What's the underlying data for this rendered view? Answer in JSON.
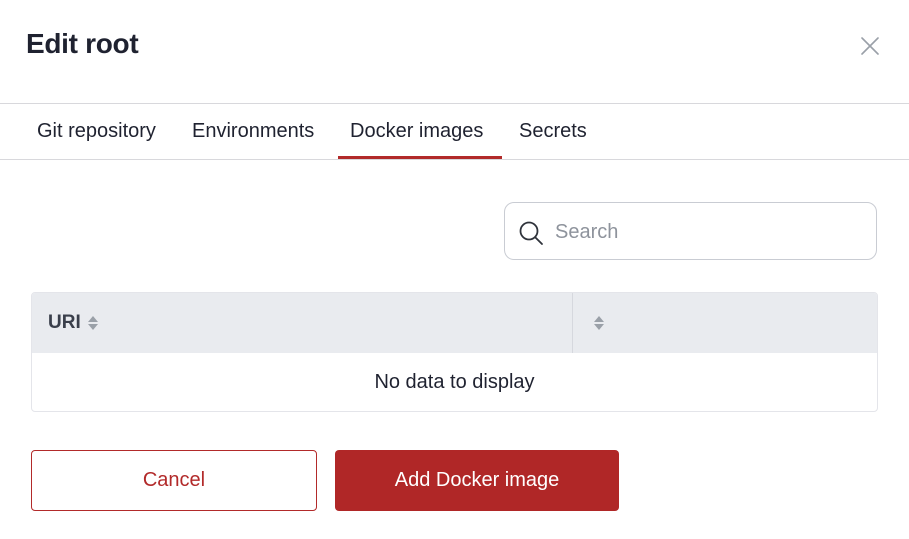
{
  "dialog": {
    "title": "Edit root",
    "close_icon": "close-icon"
  },
  "tabs": [
    {
      "label": "Git repository",
      "active": false
    },
    {
      "label": "Environments",
      "active": false
    },
    {
      "label": "Docker images",
      "active": true
    },
    {
      "label": "Secrets",
      "active": false
    }
  ],
  "search": {
    "placeholder": "Search",
    "value": "",
    "icon": "search-icon"
  },
  "table": {
    "columns": [
      {
        "label": "URI",
        "sort_icon": "sort-icon"
      },
      {
        "label": "",
        "sort_icon": "sort-icon"
      }
    ],
    "rows": [],
    "empty_message": "No data to display"
  },
  "actions": {
    "cancel_label": "Cancel",
    "add_label": "Add Docker image"
  },
  "colors": {
    "accent": "#b02727",
    "header_bg": "#e9ebef",
    "border": "#d8d8dc"
  }
}
